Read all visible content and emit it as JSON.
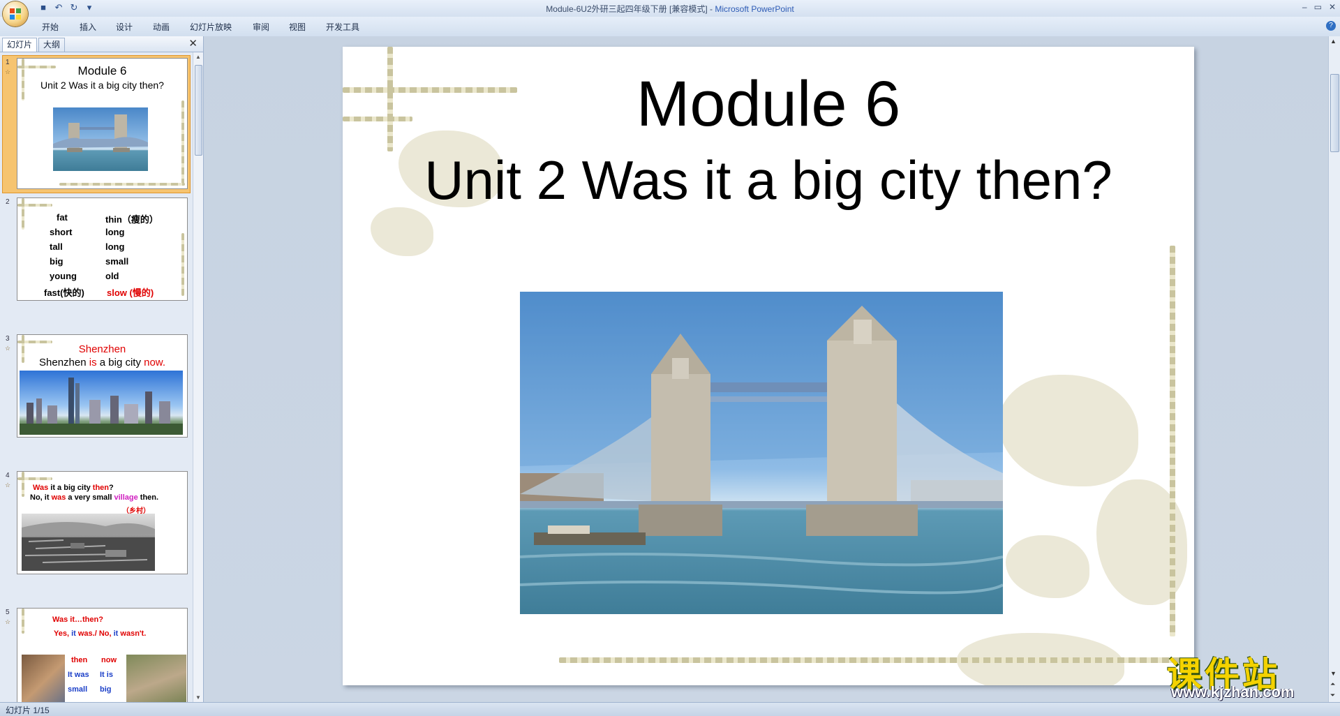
{
  "window": {
    "title": "Module-6U2外研三起四年级下册 [兼容模式] - ",
    "app_name": "Microsoft PowerPoint",
    "controls": [
      "–",
      "▭",
      "✕"
    ]
  },
  "quick_access": {
    "icons": [
      "save-icon",
      "undo-icon",
      "redo-icon",
      "customize-icon"
    ],
    "glyphs": [
      "■",
      "↶",
      "↻",
      "▾"
    ]
  },
  "menu": {
    "tabs": [
      "开始",
      "插入",
      "设计",
      "动画",
      "幻灯片放映",
      "审阅",
      "视图",
      "开发工具"
    ],
    "help": "?"
  },
  "left_panel": {
    "tabs": [
      "幻灯片",
      "大纲"
    ],
    "close": "✕"
  },
  "thumbnails": [
    {
      "number": "1",
      "title": "Module 6",
      "subtitle": "Unit 2  Was it a big city then?"
    },
    {
      "number": "2",
      "rows": [
        {
          "left": "fat",
          "right": "thin（瘦的）"
        },
        {
          "left": "short",
          "right": "long"
        },
        {
          "left": "tall",
          "right": "long"
        },
        {
          "left": "big",
          "right": "small"
        },
        {
          "left": "young",
          "right": "old"
        },
        {
          "left": "fast(快的)",
          "right": "slow (慢的)"
        }
      ]
    },
    {
      "number": "3",
      "title": "Shenzhen",
      "line_a": "Shenzhen ",
      "line_b": "is",
      "line_c": " a big city ",
      "line_d": "now."
    },
    {
      "number": "4",
      "q1": "Was",
      "q2": " it a big city ",
      "q3": "then",
      "q4": "?",
      "a1": "No, it ",
      "a2": "was",
      "a3": " a very small ",
      "a4": "village",
      "a5": " then.",
      "note": "（乡村）"
    },
    {
      "number": "5",
      "line1": "Was it…then?",
      "line2a": "Yes, ",
      "line2b": "it",
      "line2c": " was./ No, ",
      "line2d": "it",
      "line2e": " wasn't.",
      "col1": [
        "then",
        "It was",
        "small"
      ],
      "col2": [
        "now",
        "It is",
        "big"
      ]
    }
  ],
  "slide": {
    "title": "Module 6",
    "subtitle": "Unit 2  Was it a big city then?"
  },
  "watermark": {
    "text": "课件站",
    "url": "www.kjzhan.com"
  },
  "status": {
    "slide_indicator": "幻灯片 1/15"
  }
}
